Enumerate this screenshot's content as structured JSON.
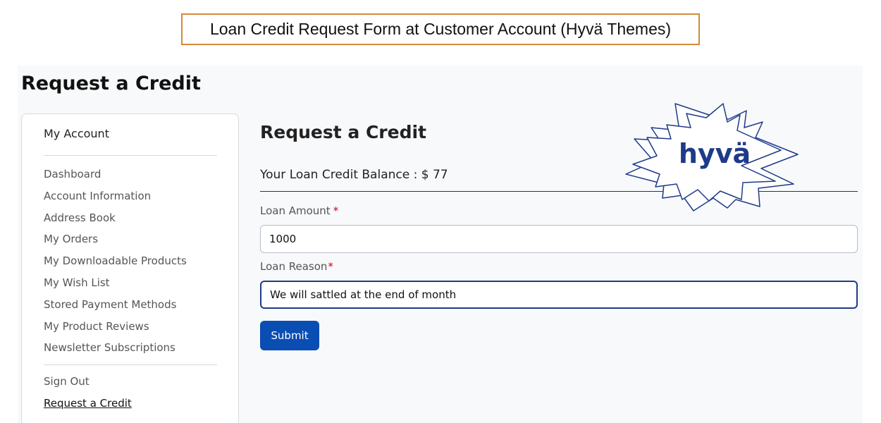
{
  "caption": "Loan Credit Request Form at Customer Account (Hyvä Themes)",
  "page_title": "Request a Credit",
  "sidebar": {
    "heading": "My Account",
    "items": [
      {
        "label": "Dashboard"
      },
      {
        "label": "Account Information"
      },
      {
        "label": "Address Book"
      },
      {
        "label": "My Orders"
      },
      {
        "label": "My Downloadable Products"
      },
      {
        "label": "My Wish List"
      },
      {
        "label": "Stored Payment Methods"
      },
      {
        "label": "My Product Reviews"
      },
      {
        "label": "Newsletter Subscriptions"
      }
    ],
    "bottom_items": [
      {
        "label": "Sign Out"
      },
      {
        "label": "Request a Credit",
        "active": true
      }
    ]
  },
  "form": {
    "title": "Request a Credit",
    "balance": "Your Loan Credit Balance : $ 77",
    "amount_label": "Loan Amount",
    "amount_value": "1000",
    "reason_label": "Loan Reason",
    "reason_value": "We will sattled at the end of month",
    "required_mark": "*",
    "submit_label": "Submit"
  },
  "logo": {
    "text": "hyvä",
    "color": "#1e3a8a"
  }
}
